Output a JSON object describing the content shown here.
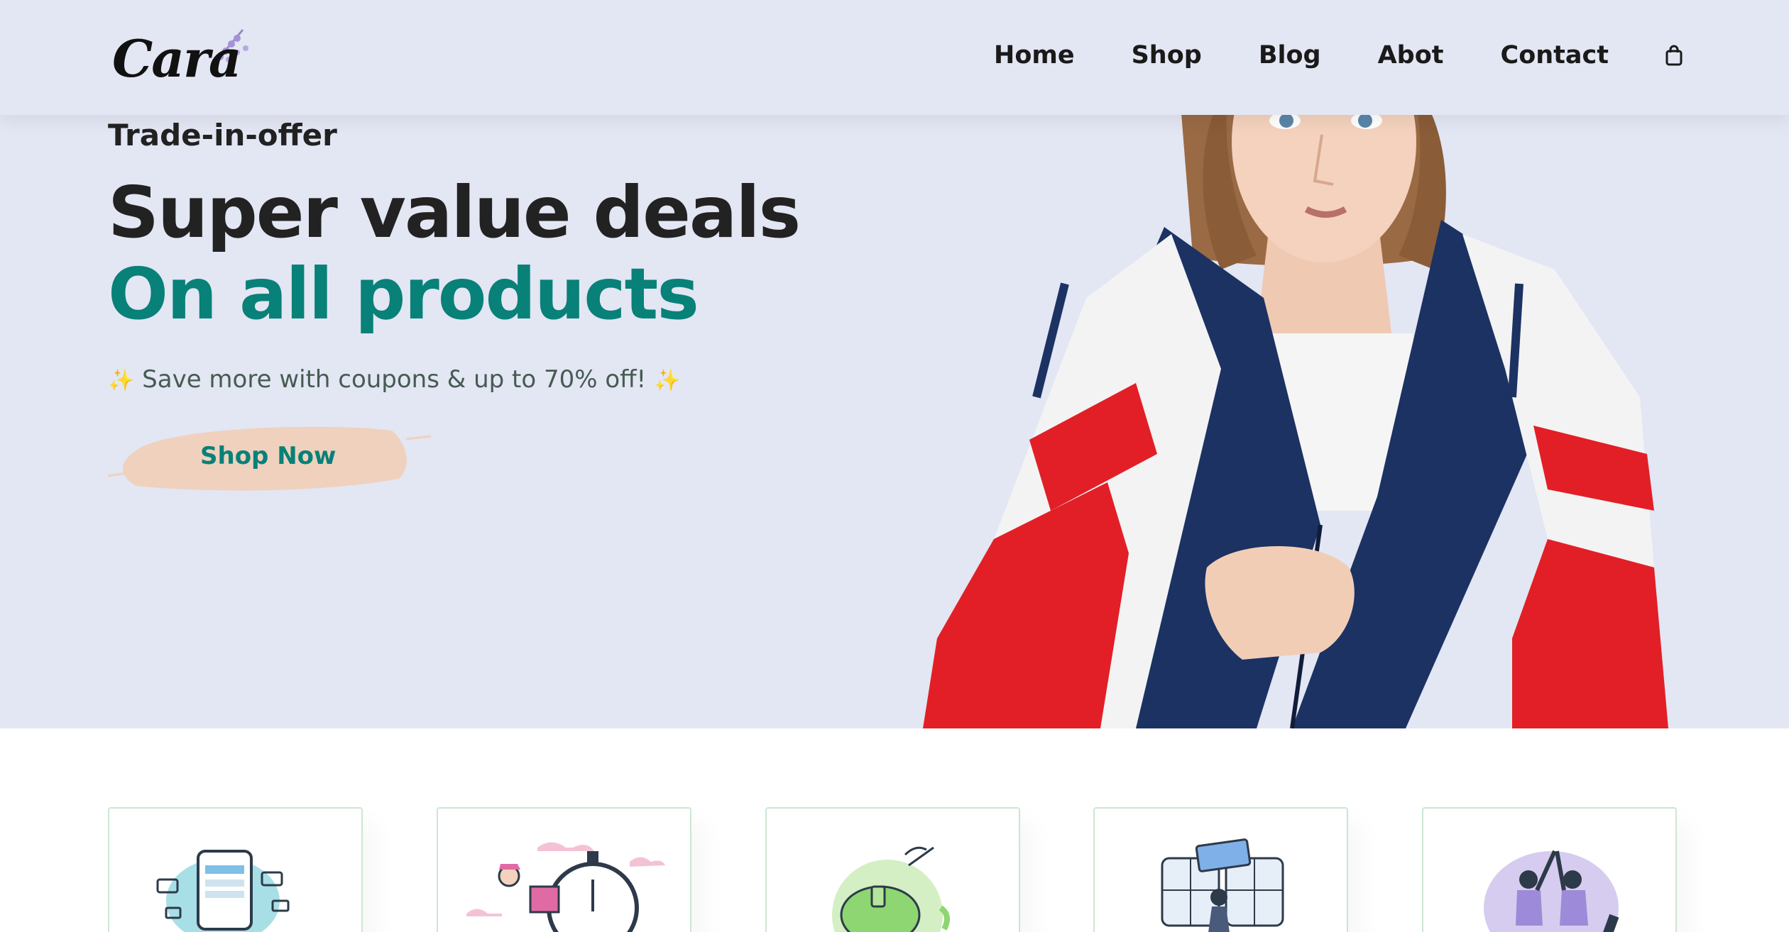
{
  "brand": {
    "logo_text": "Cara"
  },
  "nav": {
    "items": [
      {
        "label": "Home"
      },
      {
        "label": "Shop"
      },
      {
        "label": "Blog"
      },
      {
        "label": "Abot"
      },
      {
        "label": "Contact"
      }
    ],
    "cart_icon": "shopping-bag-icon"
  },
  "hero": {
    "eyebrow": "Trade-in-offer",
    "headline_line1": "Super value deals",
    "headline_line2": "On all products",
    "subtext": "Save more with coupons & up to 70% off!",
    "sparkle": "✨",
    "cta_label": "Shop Now",
    "colors": {
      "background": "#e3e6f3",
      "accent": "#088178",
      "cta_brush": "#efd1bd"
    }
  },
  "features": [
    {
      "icon": "online-payment-illustration"
    },
    {
      "icon": "fast-delivery-illustration"
    },
    {
      "icon": "save-money-illustration"
    },
    {
      "icon": "promotions-illustration"
    },
    {
      "icon": "happy-sell-illustration"
    }
  ]
}
